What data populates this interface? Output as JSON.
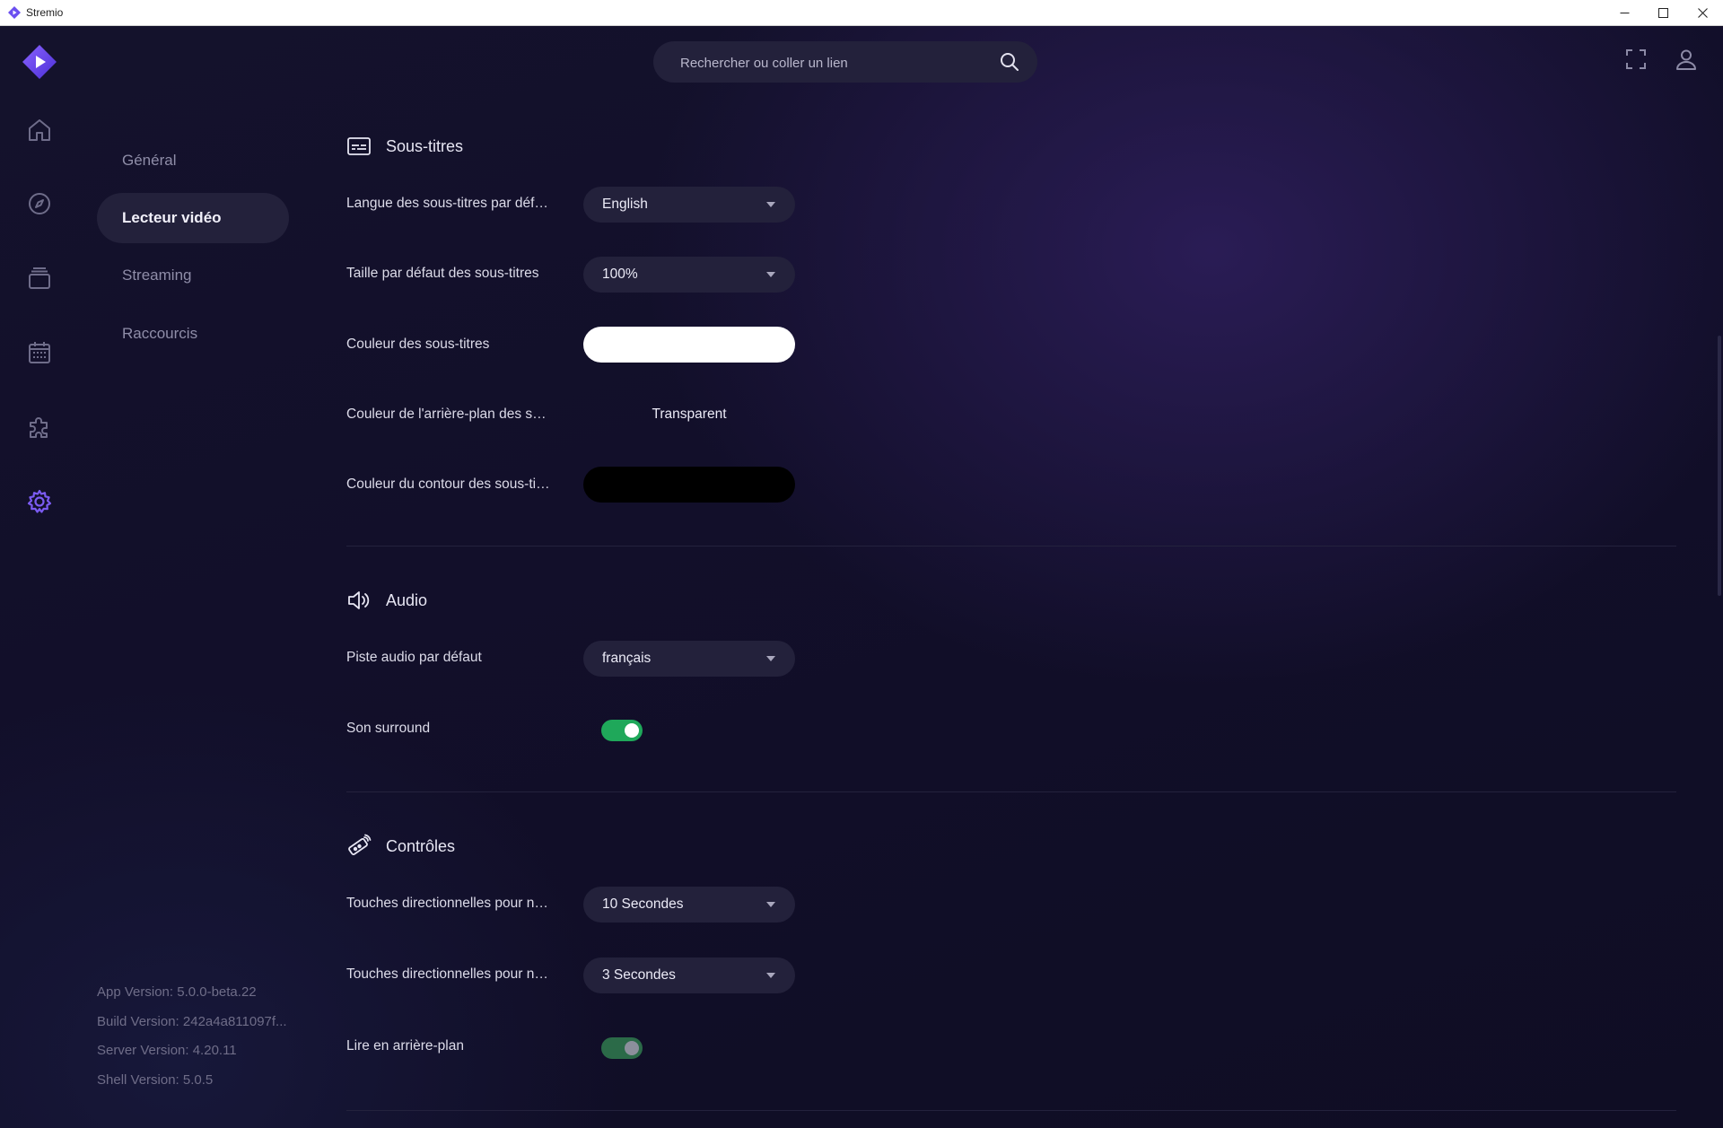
{
  "window": {
    "title": "Stremio",
    "controls": [
      "minimize",
      "maximize",
      "close"
    ]
  },
  "header": {
    "search_placeholder": "Rechercher ou coller un lien",
    "icons": [
      "search-icon",
      "fullscreen-icon",
      "user-icon"
    ]
  },
  "rail": {
    "items": [
      {
        "name": "home-icon",
        "active": false
      },
      {
        "name": "discover-icon",
        "active": false
      },
      {
        "name": "library-icon",
        "active": false
      },
      {
        "name": "calendar-icon",
        "active": false
      },
      {
        "name": "addons-icon",
        "active": false
      },
      {
        "name": "settings-icon",
        "active": true
      }
    ],
    "accent_color": "#7b5bf2"
  },
  "settings_nav": {
    "items": [
      {
        "label": "Général",
        "active": false
      },
      {
        "label": "Lecteur vidéo",
        "active": true
      },
      {
        "label": "Streaming",
        "active": false
      },
      {
        "label": "Raccourcis",
        "active": false
      }
    ]
  },
  "versions": {
    "app": "App Version: 5.0.0-beta.22",
    "build": "Build Version: 242a4a811097f...",
    "server": "Server Version: 4.20.11",
    "shell": "Shell Version: 5.0.5"
  },
  "sections": {
    "subtitles": {
      "title": "Sous-titres",
      "language_label": "Langue des sous-titres par défaut",
      "language_value": "English",
      "size_label": "Taille par défaut des sous-titres",
      "size_value": "100%",
      "color_label": "Couleur des sous-titres",
      "color_value": "#ffffff",
      "bg_color_label": "Couleur de l'arrière-plan des sous-titres",
      "bg_color_value": "Transparent",
      "outline_label": "Couleur du contour des sous-titres",
      "outline_value": "#000000"
    },
    "audio": {
      "title": "Audio",
      "track_label": "Piste audio par défaut",
      "track_value": "français",
      "surround_label": "Son surround",
      "surround_on": true
    },
    "controls": {
      "title": "Contrôles",
      "seek_label": "Touches directionnelles pour naviguer",
      "seek_value": "10 Secondes",
      "seek_short_label": "Touches directionnelles pour naviguer (Shift)",
      "seek_short_value": "3 Secondes",
      "background_label": "Lire en arrière-plan",
      "background_on": true
    }
  },
  "colors": {
    "toggle_on": "#1fa85a",
    "toggle_on_dim": "#2b6a48",
    "surface": "#23213b"
  }
}
